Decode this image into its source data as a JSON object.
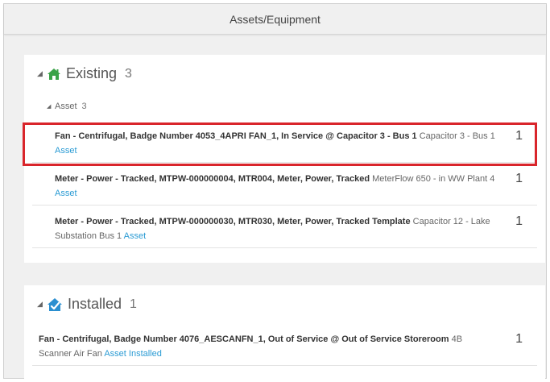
{
  "header": {
    "title": "Assets/Equipment"
  },
  "existing": {
    "label": "Existing",
    "count": "3",
    "asset_group": {
      "label": "Asset",
      "count": "3"
    },
    "rows": [
      {
        "title": "Fan - Centrifugal, Badge Number 4053_4APRI FAN_1, In Service @ Capacitor 3 - Bus 1",
        "location": " Capacitor 3 - Bus 1 ",
        "link": "Asset",
        "qty": "1"
      },
      {
        "title": "Meter - Power - Tracked, MTPW-000000004, MTR004, Meter, Power, Tracked",
        "location": " MeterFlow 650 - in WW Plant 4 ",
        "link": "Asset",
        "qty": "1"
      },
      {
        "title": "Meter - Power - Tracked, MTPW-000000030, MTR030, Meter, Power, Tracked Template",
        "location": " Capacitor 12 - Lake Substation Bus 1 ",
        "link": "Asset",
        "qty": "1"
      }
    ]
  },
  "installed": {
    "label": "Installed",
    "count": "1",
    "rows": [
      {
        "title": "Fan - Centrifugal, Badge Number 4076_AESCANFN_1, Out of Service @ Out of Service Storeroom",
        "location": " 4B Scanner Air Fan ",
        "link": "Asset Installed",
        "qty": "1"
      }
    ]
  },
  "colors": {
    "link": "#2a9bd4",
    "home_icon": "#3aa348",
    "installed_icon": "#2a8fd0",
    "highlight": "#d9252b"
  },
  "icons": {
    "existing": "home-icon",
    "installed": "installed-house-check-icon"
  }
}
